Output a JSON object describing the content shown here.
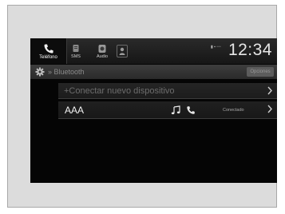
{
  "tabs": {
    "phone_label": "Teléfono",
    "messages_label": "SMS",
    "audio_label": "Audio"
  },
  "status": {
    "indicators": "▮ ▪ ▫▫▫",
    "clock": "12:34"
  },
  "header": {
    "title": "» Bluetooth",
    "options_button": "Opciones"
  },
  "list": {
    "connect_new": "+Conectar nuevo dispositivo",
    "device_name": "AAA",
    "device_status": "Conectado"
  },
  "colors": {
    "screen_bg": "#050505",
    "frame_bg": "#dcdcdc"
  }
}
